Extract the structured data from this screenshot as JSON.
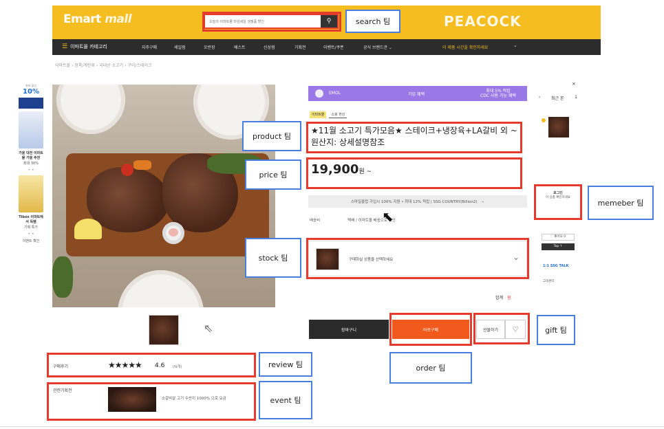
{
  "header": {
    "logo_main": "Emart",
    "logo_sub": "mall",
    "search_placeholder": "오늘의 이마트몰 마감세일 생필품 할인",
    "search_icon": "magnifier-icon",
    "brand_right": "PEACOCK"
  },
  "nav": {
    "category_label": "이마트몰 카테고리",
    "items": [
      "자주구매",
      "세일점",
      "오반장",
      "베스트",
      "신상점",
      "기획전",
      "이벤트/쿠폰",
      "공식 브랜드관 ⌄"
    ],
    "promo": "이 제품 시간을 확인하세요"
  },
  "breadcrumb": "이마트몰 › 정육/계란류 › 국내산 소고기 › 구이/스테이크",
  "left_sidebar": {
    "rate": "10%",
    "rate_sub": "최대 할인",
    "item1_title": "가을 대전 이마트몰 가을 추천",
    "item1_sub": "최대 30%",
    "dots": "• •",
    "item2_title": "Tibox 이마트에서 득템",
    "item2_sub": "기획 특가",
    "extra": "이벤트 확인"
  },
  "member_banner": {
    "left": "EMOL",
    "mid": "가입 혜택",
    "right_line1": "최대 5% 적립",
    "right_line2": "CDC 사용 가능 혜택"
  },
  "tags": [
    "이마트몰",
    "쇼핑 편성"
  ],
  "product": {
    "title": "★11월 소고기 특가모음★ 스테이크+냉장육+LA갈비 외 ~",
    "title_line2": "원산지: 상세설명참조",
    "price": "19,900",
    "price_unit": "원 ~",
    "card_bar": "스마일클럽 가입시 100% 지원 • 최대 12% 적립 | SSG COUNTRY(Billion2)",
    "ship_label": "배송비",
    "ship_value": "택배 / 이마트몰 배송으로 확인",
    "option_text": "구매하실 상품을 선택하세요",
    "total_label": "합계",
    "total_value": "원"
  },
  "buttons": {
    "cart": "장바구니",
    "buy": "바로구매",
    "gift": "선물하기",
    "wish_icon": "heart-icon"
  },
  "review": {
    "label": "구매후기",
    "stars": "★★★★★",
    "score": "4.6",
    "count": "(N개)"
  },
  "event": {
    "label": "관련기획전",
    "text": "소갈비살 고기 수산이 1000% 으로 요금"
  },
  "right_panel": {
    "close": "×",
    "recent": "최근 본",
    "recent_count": "1",
    "member_title": "로그인",
    "member_sub": "이 상품 확인하세요",
    "like": "♡ 좋아요 0",
    "top": "Top ↑",
    "talk": "1:1 SSG TALK",
    "cs": "고객센터"
  },
  "annotations": {
    "search": "search 팀",
    "product": "product 팀",
    "price": "price 팀",
    "stock": "stock 팀",
    "member": "memeber 팀",
    "gift": "gift 팀",
    "order": "order 팀",
    "review": "review 팀",
    "event": "event 팀"
  },
  "colors": {
    "header_yellow": "#f5bd1f",
    "nav_dark": "#2c2c2c",
    "buy_orange": "#f25a1d",
    "annotation_red": "#e53b2c",
    "annotation_blue": "#4a7de0",
    "member_purple": "#9b78e8"
  }
}
